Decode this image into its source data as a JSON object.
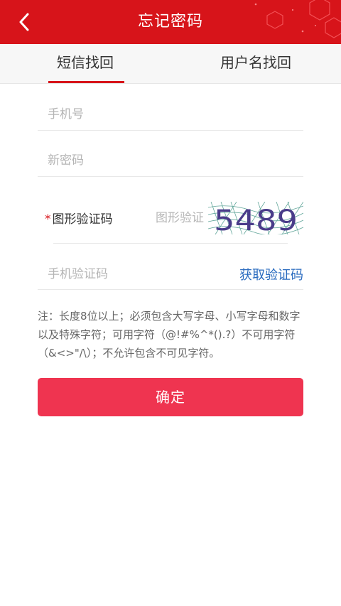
{
  "header": {
    "title": "忘记密码",
    "bg_color": "#d7141a"
  },
  "tabs": {
    "sms": "短信找回",
    "username": "用户名找回",
    "active": "sms"
  },
  "form": {
    "phone_placeholder": "手机号",
    "new_password_placeholder": "新密码",
    "captcha_label": "图形验证码",
    "captcha_required_mark": "*",
    "captcha_placeholder": "图形验证码",
    "captcha_text": "5489",
    "sms_code_placeholder": "手机验证码",
    "get_code_label": "获取验证码"
  },
  "note": "注：长度8位以上；必须包含大写字母、小写字母和数字以及特殊字符；可用字符（@!#%^*().?）不可用字符（&<>\"/\\）；不允许包含不可见字符。",
  "confirm_label": "确定",
  "colors": {
    "accent": "#d7141a",
    "button": "#ef3450",
    "link": "#2a6bbf"
  }
}
